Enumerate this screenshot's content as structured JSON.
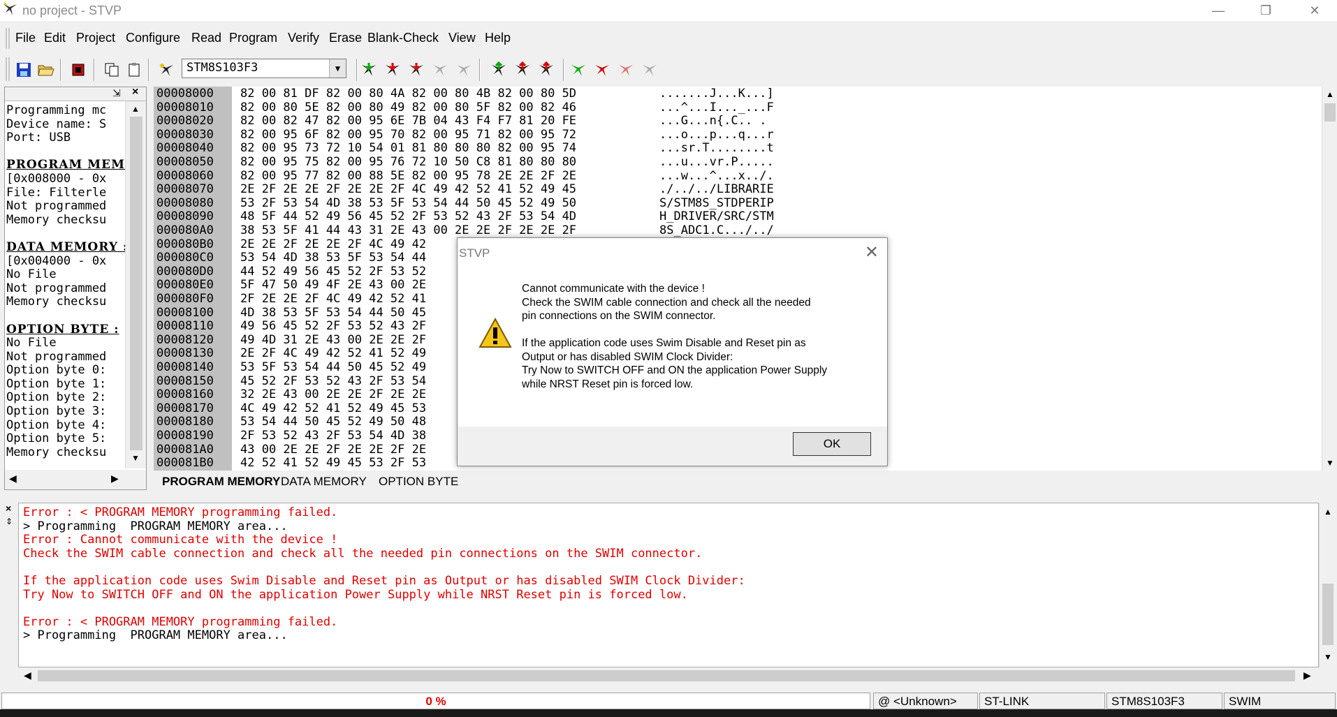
{
  "window": {
    "title": "no project - STVP",
    "minimize": "—",
    "restore": "❐",
    "close": "✕"
  },
  "menu": [
    "File",
    "Edit",
    "Project",
    "Configure",
    "Read",
    "Program",
    "Verify",
    "Erase",
    "Blank-Check",
    "View",
    "Help"
  ],
  "toolbar": {
    "device": "STM8S103F3"
  },
  "left_panel": {
    "lines": [
      {
        "text": "Programming mc",
        "hd": false
      },
      {
        "text": "Device name: S",
        "hd": false
      },
      {
        "text": "Port: USB",
        "hd": false
      },
      {
        "text": "",
        "hd": false
      },
      {
        "text": "PROGRAM MEMOI",
        "hd": true
      },
      {
        "text": "[0x008000 - 0x",
        "hd": false
      },
      {
        "text": "File: Filterle",
        "hd": false
      },
      {
        "text": "Not programmed",
        "hd": false
      },
      {
        "text": "Memory checksu",
        "hd": false
      },
      {
        "text": "",
        "hd": false
      },
      {
        "text": "DATA MEMORY :",
        "hd": true
      },
      {
        "text": "[0x004000 - 0x",
        "hd": false
      },
      {
        "text": "No File",
        "hd": false
      },
      {
        "text": "Not programmed",
        "hd": false
      },
      {
        "text": "Memory checksu",
        "hd": false
      },
      {
        "text": "",
        "hd": false
      },
      {
        "text": "OPTION BYTE :",
        "hd": true
      },
      {
        "text": "No File",
        "hd": false
      },
      {
        "text": "Not programmed",
        "hd": false
      },
      {
        "text": "Option byte 0:",
        "hd": false
      },
      {
        "text": "Option byte 1:",
        "hd": false
      },
      {
        "text": "Option byte 2:",
        "hd": false
      },
      {
        "text": "Option byte 3:",
        "hd": false
      },
      {
        "text": "Option byte 4:",
        "hd": false
      },
      {
        "text": "Option byte 5:",
        "hd": false
      },
      {
        "text": "Memory checksu",
        "hd": false
      }
    ]
  },
  "hex": [
    {
      "addr": "00008000",
      "bytes": "82 00 81 DF 82 00 80 4A 82 00 80 4B 82 00 80 5D",
      "ascii": ".......J...K...]"
    },
    {
      "addr": "00008010",
      "bytes": "82 00 80 5E 82 00 80 49 82 00 80 5F 82 00 82 46",
      "ascii": "...^...I..._...F"
    },
    {
      "addr": "00008020",
      "bytes": "82 00 82 47 82 00 95 6E 7B 04 43 F4 F7 81 20 FE",
      "ascii": "...G...n{.C.. ."
    },
    {
      "addr": "00008030",
      "bytes": "82 00 95 6F 82 00 95 70 82 00 95 71 82 00 95 72",
      "ascii": "...o...p...q...r"
    },
    {
      "addr": "00008040",
      "bytes": "82 00 95 73 72 10 54 01 81 80 80 80 82 00 95 74",
      "ascii": "...sr.T........t"
    },
    {
      "addr": "00008050",
      "bytes": "82 00 95 75 82 00 95 76 72 10 50 C8 81 80 80 80",
      "ascii": "...u...vr.P....."
    },
    {
      "addr": "00008060",
      "bytes": "82 00 95 77 82 00 88 5E 82 00 95 78 2E 2E 2F 2E",
      "ascii": "...w...^...x../."
    },
    {
      "addr": "00008070",
      "bytes": "2E 2F 2E 2E 2F 2E 2E 2F 4C 49 42 52 41 52 49 45",
      "ascii": "./../../LIBRARIE"
    },
    {
      "addr": "00008080",
      "bytes": "53 2F 53 54 4D 38 53 5F 53 54 44 50 45 52 49 50",
      "ascii": "S/STM8S_STDPERIP"
    },
    {
      "addr": "00008090",
      "bytes": "48 5F 44 52 49 56 45 52 2F 53 52 43 2F 53 54 4D",
      "ascii": "H_DRIVER/SRC/STM"
    },
    {
      "addr": "000080A0",
      "bytes": "38 53 5F 41 44 43 31 2E 43 00 2E 2E 2F 2E 2E 2F",
      "ascii": "8S_ADC1.C.../../"
    },
    {
      "addr": "000080B0",
      "bytes": "2E 2E 2F 2E 2E 2F 4C 49 42",
      "ascii": ""
    },
    {
      "addr": "000080C0",
      "bytes": "53 54 4D 38 53 5F 53 54 44",
      "ascii": ""
    },
    {
      "addr": "000080D0",
      "bytes": "44 52 49 56 45 52 2F 53 52",
      "ascii": ""
    },
    {
      "addr": "000080E0",
      "bytes": "5F 47 50 49 4F 2E 43 00 2E",
      "ascii": ""
    },
    {
      "addr": "000080F0",
      "bytes": "2F 2E 2E 2F 4C 49 42 52 41",
      "ascii": ""
    },
    {
      "addr": "00008100",
      "bytes": "4D 38 53 5F 53 54 44 50 45",
      "ascii": ""
    },
    {
      "addr": "00008110",
      "bytes": "49 56 45 52 2F 53 52 43 2F",
      "ascii": ""
    },
    {
      "addr": "00008120",
      "bytes": "49 4D 31 2E 43 00 2E 2E 2F",
      "ascii": ""
    },
    {
      "addr": "00008130",
      "bytes": "2E 2F 4C 49 42 52 41 52 49",
      "ascii": ""
    },
    {
      "addr": "00008140",
      "bytes": "53 5F 53 54 44 50 45 52 49",
      "ascii": ""
    },
    {
      "addr": "00008150",
      "bytes": "45 52 2F 53 52 43 2F 53 54",
      "ascii": ""
    },
    {
      "addr": "00008160",
      "bytes": "32 2E 43 00 2E 2E 2F 2E 2E",
      "ascii": ""
    },
    {
      "addr": "00008170",
      "bytes": "4C 49 42 52 41 52 49 45 53",
      "ascii": ""
    },
    {
      "addr": "00008180",
      "bytes": "53 54 44 50 45 52 49 50 48",
      "ascii": ""
    },
    {
      "addr": "00008190",
      "bytes": "2F 53 52 43 2F 53 54 4D 38",
      "ascii": ""
    },
    {
      "addr": "000081A0",
      "bytes": "43 00 2E 2E 2F 2E 2E 2F 2E",
      "ascii": ""
    },
    {
      "addr": "000081B0",
      "bytes": "42 52 41 52 49 45 53 2F 53",
      "ascii": ""
    }
  ],
  "tabs": [
    "PROGRAM MEMORY",
    "DATA MEMORY",
    "OPTION BYTE"
  ],
  "log": [
    {
      "text": "Error : < PROGRAM MEMORY programming failed.",
      "err": true
    },
    {
      "text": "> Programming  PROGRAM MEMORY area...",
      "err": false
    },
    {
      "text": "Error : Cannot communicate with the device !",
      "err": true
    },
    {
      "text": "Check the SWIM cable connection and check all the needed pin connections on the SWIM connector.",
      "err": true
    },
    {
      "text": "",
      "err": false
    },
    {
      "text": "If the application code uses Swim Disable and Reset pin as Output or has disabled SWIM Clock Divider:",
      "err": true
    },
    {
      "text": "Try Now to SWITCH OFF and ON the application Power Supply while NRST Reset pin is forced low.",
      "err": true
    },
    {
      "text": "",
      "err": false
    },
    {
      "text": "Error : < PROGRAM MEMORY programming failed.",
      "err": true
    },
    {
      "text": "> Programming  PROGRAM MEMORY area...",
      "err": false
    }
  ],
  "status": {
    "progress": "0 %",
    "port": "@ <Unknown>",
    "tool": "ST-LINK",
    "device": "STM8S103F3",
    "protocol": "SWIM"
  },
  "dialog": {
    "title": "STVP",
    "lines": [
      "Cannot communicate with the device !",
      "Check the SWIM cable connection and check all the needed",
      "pin connections on the SWIM connector.",
      "",
      "If the application code uses Swim Disable and Reset pin as",
      "Output or has disabled SWIM Clock Divider:",
      "Try Now to SWITCH OFF and ON the application Power Supply",
      "while NRST Reset pin is forced low."
    ],
    "ok": "OK"
  },
  "colors": {
    "error": "#e00000",
    "hex_addr_bg": "#c0c0c0"
  }
}
